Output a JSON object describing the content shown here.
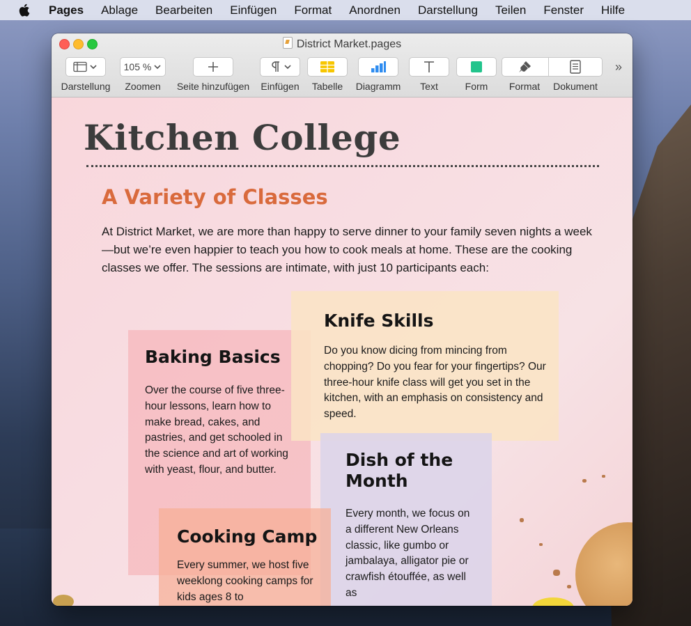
{
  "menubar": {
    "app_name": "Pages",
    "items": [
      "Ablage",
      "Bearbeiten",
      "Einfügen",
      "Format",
      "Anordnen",
      "Darstellung",
      "Teilen",
      "Fenster",
      "Hilfe"
    ]
  },
  "window": {
    "title": "District Market.pages"
  },
  "toolbar": {
    "zoom_value": "105 %",
    "labels": {
      "view": "Darstellung",
      "zoom": "Zoomen",
      "add_page": "Seite hinzufügen",
      "insert": "Einfügen",
      "table": "Tabelle",
      "chart": "Diagramm",
      "text": "Text",
      "shape": "Form",
      "format": "Format",
      "document": "Dokument"
    },
    "overflow_glyph": "»"
  },
  "document": {
    "title": "Kitchen College",
    "subtitle": "A Variety of Classes",
    "intro": "At District Market, we are more than happy to serve dinner to your family seven nights a week—but we’re even happier to teach you how to cook meals at home. These are the cooking classes we offer. The sessions are intimate, with just 10 participants each:",
    "cards": {
      "baking": {
        "title": "Baking Basics",
        "body": "Over the course of five three-hour lessons, learn how to make bread, cakes, and pastries, and get schooled in the science and art of working with yeast, flour, and butter."
      },
      "knife": {
        "title": "Knife Skills",
        "body": "Do you know dicing from mincing from chopping? Do you fear for your fingertips? Our three-hour knife class will get you set in the kitchen, with an emphasis on consistency and speed."
      },
      "dish": {
        "title": "Dish of the Month",
        "body": "Every month, we focus on a different New Orleans classic, like gumbo or jambalaya, alligator pie or crawfish étouffée, as well as"
      },
      "camp": {
        "title": "Cooking Camp",
        "body": "Every summer, we host five weeklong cooking camps for kids ages 8 to"
      }
    }
  },
  "colors": {
    "accent_orange": "#d96a3c",
    "page_pink": "#f8dde2"
  }
}
